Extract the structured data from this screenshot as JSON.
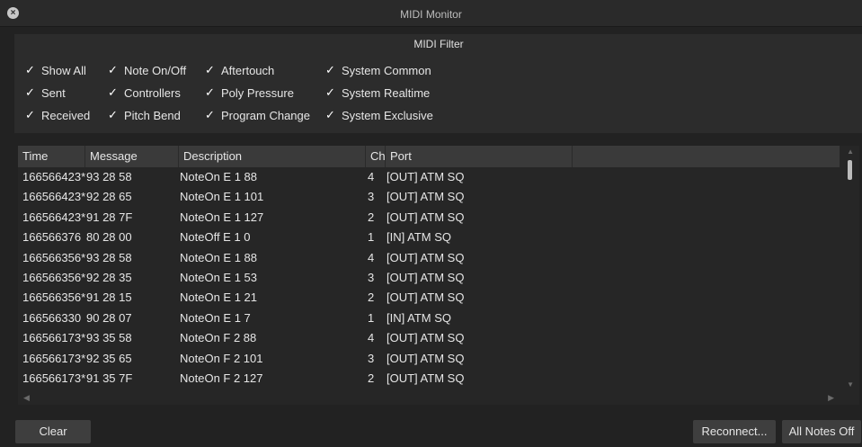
{
  "window": {
    "title": "MIDI Monitor"
  },
  "filter": {
    "header": "MIDI Filter",
    "checkboxes": [
      {
        "label": "Show All",
        "checked": "✓"
      },
      {
        "label": "Sent",
        "checked": "✓"
      },
      {
        "label": "Received",
        "checked": "✓"
      },
      {
        "label": "Note On/Off",
        "checked": "✓"
      },
      {
        "label": "Controllers",
        "checked": "✓"
      },
      {
        "label": "Pitch Bend",
        "checked": "✓"
      },
      {
        "label": "Aftertouch",
        "checked": "✓"
      },
      {
        "label": "Poly Pressure",
        "checked": "✓"
      },
      {
        "label": "Program Change",
        "checked": "✓"
      },
      {
        "label": "System Common",
        "checked": "✓"
      },
      {
        "label": "System Realtime",
        "checked": "✓"
      },
      {
        "label": "System Exclusive",
        "checked": "✓"
      }
    ]
  },
  "table": {
    "columns": [
      "Time",
      "Message",
      "Description",
      "Ch",
      "Port"
    ],
    "rows": [
      {
        "time": "166566423*",
        "message": "93 28 58",
        "description": "NoteOn E 1 88",
        "ch": "4",
        "port": "[OUT] ATM SQ"
      },
      {
        "time": "166566423*",
        "message": "92 28 65",
        "description": "NoteOn E 1 101",
        "ch": "3",
        "port": "[OUT] ATM SQ"
      },
      {
        "time": "166566423*",
        "message": "91 28 7F",
        "description": "NoteOn E 1 127",
        "ch": "2",
        "port": "[OUT] ATM SQ"
      },
      {
        "time": "166566376",
        "message": "80 28 00",
        "description": "NoteOff E 1 0",
        "ch": "1",
        "port": "[IN] ATM SQ"
      },
      {
        "time": "166566356*",
        "message": "93 28 58",
        "description": "NoteOn E 1 88",
        "ch": "4",
        "port": "[OUT] ATM SQ"
      },
      {
        "time": "166566356*",
        "message": "92 28 35",
        "description": "NoteOn E 1 53",
        "ch": "3",
        "port": "[OUT] ATM SQ"
      },
      {
        "time": "166566356*",
        "message": "91 28 15",
        "description": "NoteOn E 1 21",
        "ch": "2",
        "port": "[OUT] ATM SQ"
      },
      {
        "time": "166566330",
        "message": "90 28 07",
        "description": "NoteOn E 1 7",
        "ch": "1",
        "port": "[IN] ATM SQ"
      },
      {
        "time": "166566173*",
        "message": "93 35 58",
        "description": "NoteOn F 2 88",
        "ch": "4",
        "port": "[OUT] ATM SQ"
      },
      {
        "time": "166566173*",
        "message": "92 35 65",
        "description": "NoteOn F 2 101",
        "ch": "3",
        "port": "[OUT] ATM SQ"
      },
      {
        "time": "166566173*",
        "message": "91 35 7F",
        "description": "NoteOn F 2 127",
        "ch": "2",
        "port": "[OUT] ATM SQ"
      }
    ]
  },
  "buttons": {
    "clear": "Clear",
    "reconnect": "Reconnect...",
    "all_notes_off": "All Notes Off"
  },
  "icons": {
    "close": "close-icon",
    "check": "checkmark-icon",
    "scroll_up": "triangle-up-icon",
    "scroll_down": "triangle-down-icon",
    "scroll_left": "triangle-left-icon",
    "scroll_right": "triangle-right-icon"
  },
  "colors": {
    "background": "#222222",
    "panel": "#2c2c2c",
    "header": "#3a3a3a",
    "text": "#e6e6e6"
  }
}
